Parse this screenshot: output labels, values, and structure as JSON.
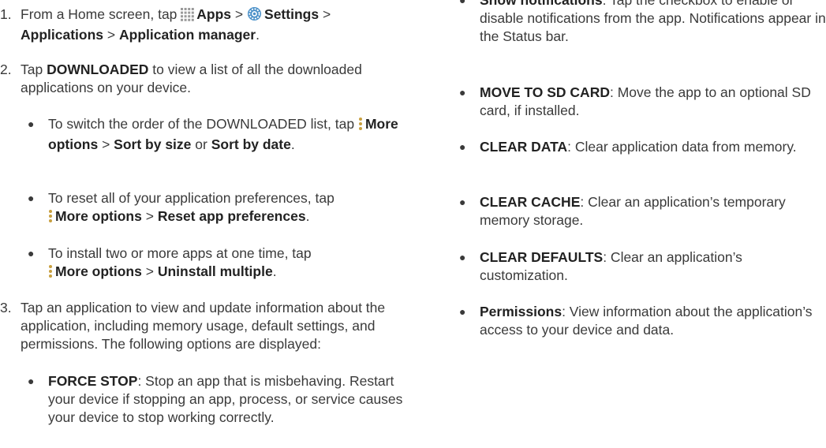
{
  "steps": [
    {
      "number": "1.",
      "p1": "From a Home screen, tap",
      "apps_icon": "apps-grid-icon",
      "apps": "Apps",
      "sep1": ">",
      "settings_icon": "settings-gear-icon",
      "settings": "Settings",
      "sep2": ">",
      "applications": "Applications",
      "sep3": ">",
      "app_manager": "Application manager",
      "end": "."
    },
    {
      "number": "2.",
      "p1": "Tap",
      "downloaded": "DOWNLOADED",
      "p2": "to view a list of all the downloaded applications on your device."
    },
    {
      "number": "3.",
      "text": "Tap an application to view and update information about the application, including memory usage, default settings, and permissions. The following options are displayed:"
    }
  ],
  "sub_bullets": [
    {
      "p1": "To switch the order of the DOWNLOADED list, tap",
      "icon": "more-options-icon",
      "more": "More options",
      "sep1": ">",
      "b1": "Sort by size",
      "or": "or",
      "b2": "Sort by date",
      "end": "."
    },
    {
      "p1": "To reset all of your application preferences, tap",
      "icon": "more-options-icon",
      "more": "More options",
      "sep1": ">",
      "b1": "Reset app preferences",
      "end": "."
    },
    {
      "p1": "To install two or more apps at one time, tap",
      "icon": "more-options-icon",
      "more": "More options",
      "sep1": ">",
      "b1": "Uninstall multiple",
      "end": "."
    }
  ],
  "options": [
    {
      "term": "FORCE STOP",
      "desc": ": Stop an app that is misbehaving. Restart your device if stopping an app, process, or service causes your device to stop working correctly."
    },
    {
      "term": "Show notifications",
      "desc": ": Tap the checkbox to enable or disable notifications from the app. Notifications appear in the Status bar."
    },
    {
      "term": "MOVE TO SD CARD",
      "desc": ": Move the app to an optional SD card, if installed."
    },
    {
      "term": "CLEAR DATA",
      "desc": ": Clear application data from memory."
    },
    {
      "term": "CLEAR CACHE",
      "desc": ": Clear an application’s temporary memory storage."
    },
    {
      "term": "CLEAR DEFAULTS",
      "desc": ": Clear an application’s customization."
    },
    {
      "term": "Permissions",
      "desc": ": View information about the application’s access to your device and data."
    }
  ],
  "bullet_char": "●",
  "colors": {
    "text": "#3a3a3a",
    "bold": "#222222",
    "settings_icon": "#4a90c8"
  }
}
